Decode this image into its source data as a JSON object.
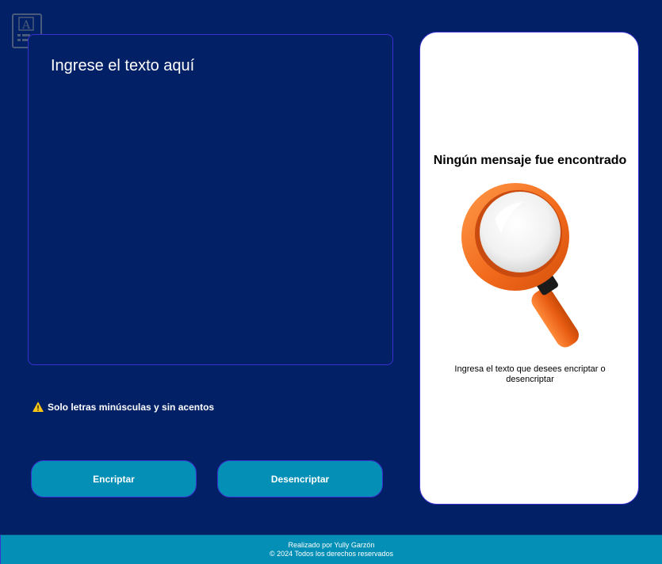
{
  "input": {
    "placeholder": "Ingrese el texto aquí",
    "value": ""
  },
  "warning": {
    "icon": "warning-icon",
    "text": "Solo letras minúsculas y sin acentos"
  },
  "buttons": {
    "encrypt_label": "Encriptar",
    "decrypt_label": "Desencriptar"
  },
  "result": {
    "title": "Ningún mensaje fue encontrado",
    "image": "magnifying-glass-illustration",
    "description": "Ingresa el texto que desees encriptar o desencriptar"
  },
  "footer": {
    "author": "Realizado por Yully Garzón",
    "copyright": "© 2024 Todos los derechos reservados"
  },
  "colors": {
    "background": "#022065",
    "accent": "#0490b6",
    "border": "#3a2fd1",
    "card": "#ffffff"
  }
}
